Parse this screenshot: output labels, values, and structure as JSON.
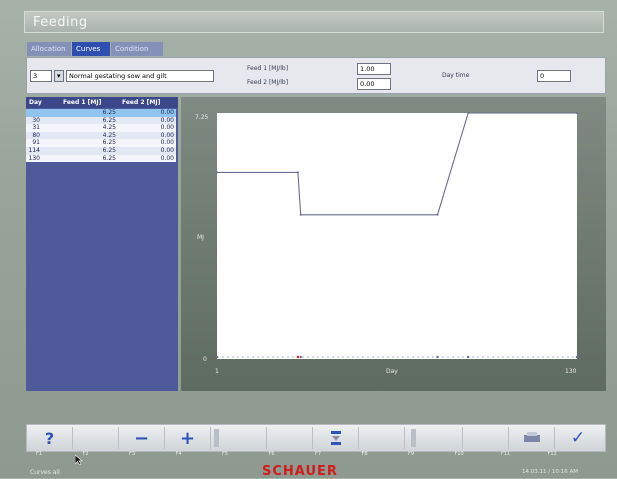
{
  "window": {
    "title": "Feeding"
  },
  "tabs": [
    {
      "label": "Allocation",
      "active": false
    },
    {
      "label": "Curves",
      "active": true
    },
    {
      "label": "Condition",
      "active": false
    }
  ],
  "controls": {
    "curve_number": "3",
    "curve_name": "Normal gestating sow and gilt",
    "feed1_label": "Feed 1 [MJ/lb]",
    "feed1_value": "1.00",
    "feed2_label": "Feed 2 [MJ/lb]",
    "feed2_value": "0.00",
    "day_time_label": "Day time",
    "day_time_value": "0"
  },
  "table": {
    "headers": [
      "Day",
      "Feed 1 [MJ]",
      "Feed 2 [MJ]"
    ],
    "rows": [
      {
        "day": "",
        "feed1": "6.25",
        "feed2": "0.00"
      },
      {
        "day": "30",
        "feed1": "6.25",
        "feed2": "0.00"
      },
      {
        "day": "31",
        "feed1": "4.25",
        "feed2": "0.00"
      },
      {
        "day": "80",
        "feed1": "4.25",
        "feed2": "0.00"
      },
      {
        "day": "91",
        "feed1": "6.25",
        "feed2": "0.00"
      },
      {
        "day": "114",
        "feed1": "6.25",
        "feed2": "0.00"
      },
      {
        "day": "130",
        "feed1": "6.25",
        "feed2": "0.00"
      }
    ]
  },
  "chart_data": {
    "type": "line",
    "xlabel": "Day",
    "ylabel": "MJ",
    "xlim": [
      1,
      130
    ],
    "ylim": [
      0,
      7.25
    ],
    "x_ticks": [
      "1",
      "130"
    ],
    "y_ticks": [
      "7.25",
      "0"
    ],
    "series": [
      {
        "x": [
          1,
          30,
          31,
          80,
          91,
          130
        ],
        "y": [
          5.5,
          5.5,
          4.25,
          4.25,
          7.25,
          7.25
        ]
      }
    ],
    "line_color": "#6a6c92",
    "marker_color": "#e02020"
  },
  "toolbar": {
    "help_label": "?",
    "minus_label": "−",
    "plus_label": "+",
    "ok_label": "✓",
    "fkeys": [
      "F1",
      "F2",
      "F3",
      "F4",
      "F5",
      "F6",
      "F7",
      "F8",
      "F9",
      "F10",
      "F11",
      "F12"
    ]
  },
  "footer": {
    "status": "Curves all",
    "brand": "SCHAUER",
    "datetime": "14.03.11 / 10:16 AM"
  },
  "colors": {
    "accent": "#2f4fb0",
    "brand": "#d21b1b"
  }
}
